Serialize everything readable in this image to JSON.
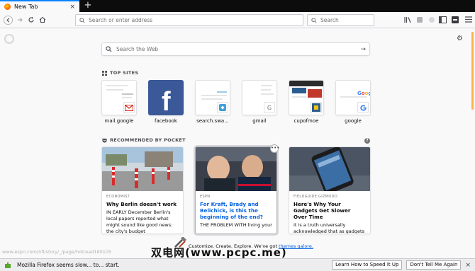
{
  "tab": {
    "title": "New Tab",
    "close": "×",
    "new_tab": "+"
  },
  "urlbar": {
    "placeholder": "Search or enter address"
  },
  "searchbar": {
    "placeholder": "Search"
  },
  "web_search": {
    "placeholder": "Search the Web"
  },
  "top_sites": {
    "heading": "TOP SITES",
    "sites": [
      {
        "label": "mail.google",
        "mini": "M"
      },
      {
        "label": "facebook",
        "mini": "f"
      },
      {
        "label": "search.swa...",
        "mini": ""
      },
      {
        "label": "gmail",
        "mini": "G"
      },
      {
        "label": "cupofmoe",
        "mini": ""
      },
      {
        "label": "google",
        "mini": "G"
      }
    ]
  },
  "pocket": {
    "heading": "RECOMMENDED BY POCKET",
    "info": "?",
    "cards": [
      {
        "source": "ECONOMIST",
        "title": "Why Berlin doesn't work",
        "desc": "IN EARLY December Berlin's local papers reported what might sound like good news: the city's budget"
      },
      {
        "source": "ESPN",
        "title": "For Kraft, Brady and Belichick, is this the beginning of the end?",
        "desc": "THE PROBLEM WITH living your",
        "menu": "•••"
      },
      {
        "source": "FIELDGUIDE.GIZMODO",
        "title": "Here's Why Your Gadgets Get Slower Over Time",
        "desc": "It is a truth universally acknowledged that as gadgets get"
      }
    ]
  },
  "status_url": "www.espn.com/nfl/story/_/page/hotread180105",
  "customize": {
    "text": "Customize. Create. Explore. We've got ",
    "link": "themes galore."
  },
  "watermark": "双电网(www.pcpc.me)",
  "notification": {
    "text": "Mozilla Firefox seems slow... to... start.",
    "btn_speed": "Learn How to Speed It Up",
    "btn_dismiss": "Don't Tell Me Again",
    "close": "×"
  },
  "colors": {
    "accent": "#0a84ff",
    "link": "#0060df",
    "tab_strip": "#0c0c0d"
  }
}
